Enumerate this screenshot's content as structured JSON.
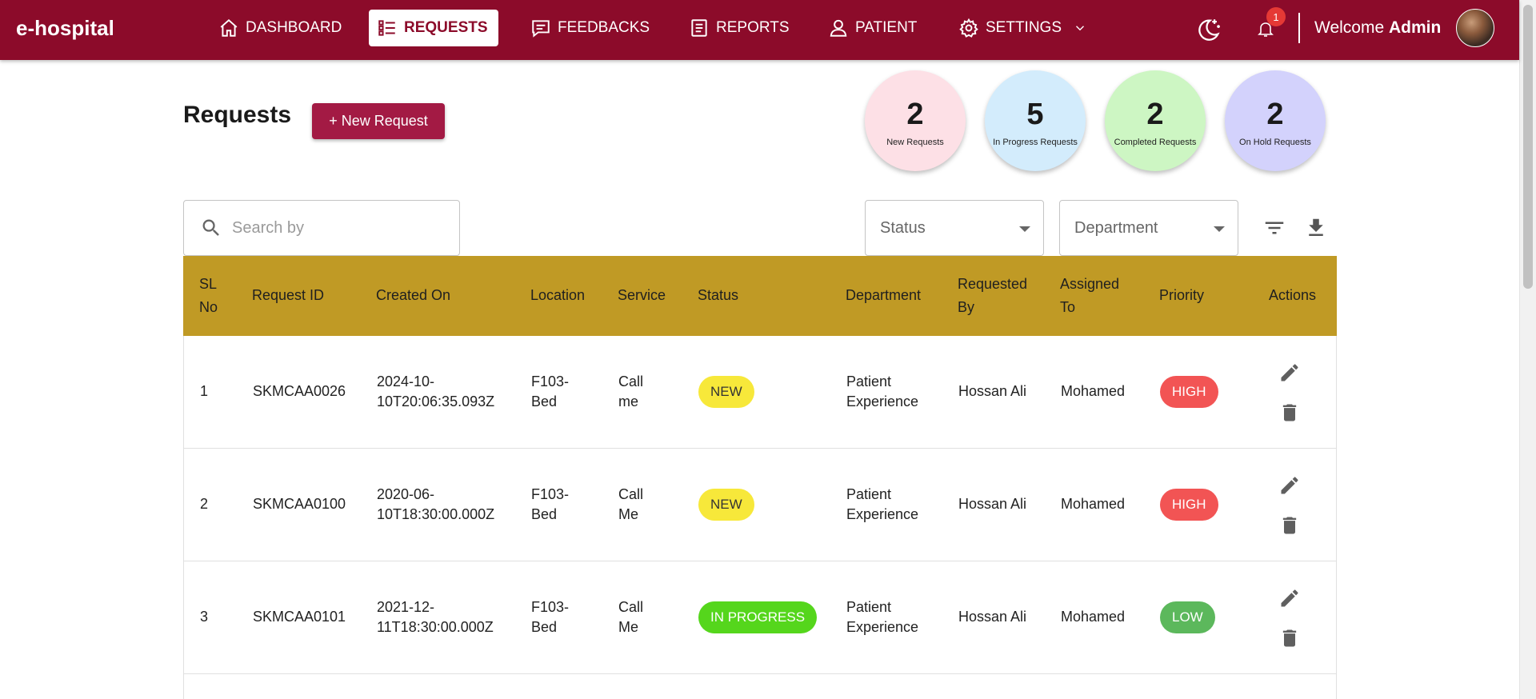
{
  "nav": {
    "brand": "e-hospital",
    "items": [
      {
        "label": "DASHBOARD",
        "icon": "home-icon",
        "active": false
      },
      {
        "label": "REQUESTS",
        "icon": "list-icon",
        "active": true
      },
      {
        "label": "FEEDBACKS",
        "icon": "chat-icon",
        "active": false
      },
      {
        "label": "REPORTS",
        "icon": "document-icon",
        "active": false
      },
      {
        "label": "PATIENT",
        "icon": "person-icon",
        "active": false
      },
      {
        "label": "SETTINGS",
        "icon": "gear-icon",
        "active": false
      }
    ],
    "notification_count": "1",
    "welcome_prefix": "Welcome",
    "user": "Admin"
  },
  "page": {
    "title": "Requests",
    "new_button": "+ New Request"
  },
  "stats": [
    {
      "value": "2",
      "label": "New Requests",
      "color": "#fde0e6"
    },
    {
      "value": "5",
      "label": "In Progress Requests",
      "color": "#d3ecfc"
    },
    {
      "value": "2",
      "label": "Completed Requests",
      "color": "#cdf6c3"
    },
    {
      "value": "2",
      "label": "On Hold Requests",
      "color": "#d3d2fc"
    }
  ],
  "filters": {
    "search_placeholder": "Search by",
    "status_label": "Status",
    "department_label": "Department"
  },
  "table": {
    "header_color": "#c09a25",
    "columns": [
      "SL\nNo",
      "Request ID",
      "Created On",
      "Location",
      "Service",
      "Status",
      "Department",
      "Requested\nBy",
      "Assigned\nTo",
      "Priority",
      "Actions"
    ],
    "rows": [
      {
        "sl": "1",
        "id": "SKMCAA0026",
        "created": "2024-10-\n10T20:06:35.093Z",
        "location": "F103-\nBed",
        "service": "Call\nme",
        "status": "NEW",
        "department": "Patient\nExperience",
        "requested_by": "Hossan Ali",
        "assigned_to": "Mohamed",
        "priority": "HIGH"
      },
      {
        "sl": "2",
        "id": "SKMCAA0100",
        "created": "2020-06-\n10T18:30:00.000Z",
        "location": "F103-\nBed",
        "service": "Call\nMe",
        "status": "NEW",
        "department": "Patient\nExperience",
        "requested_by": "Hossan Ali",
        "assigned_to": "Mohamed",
        "priority": "HIGH"
      },
      {
        "sl": "3",
        "id": "SKMCAA0101",
        "created": "2021-12-\n11T18:30:00.000Z",
        "location": "F103-\nBed",
        "service": "Call\nMe",
        "status": "IN PROGRESS",
        "department": "Patient\nExperience",
        "requested_by": "Hossan Ali",
        "assigned_to": "Mohamed",
        "priority": "LOW"
      }
    ],
    "status_colors": {
      "NEW": "#f7e83a",
      "IN PROGRESS": "#55d61c"
    },
    "priority_colors": {
      "HIGH": "#f25454",
      "LOW": "#5cb85c"
    }
  }
}
